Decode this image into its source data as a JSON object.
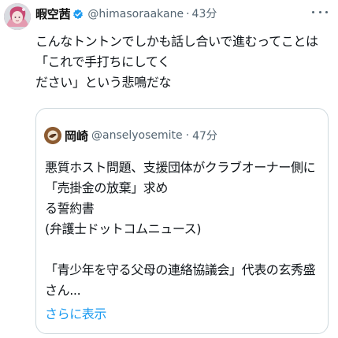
{
  "tweet": {
    "display_name": "暇空茜",
    "handle": "@himasoraakane",
    "separator": "·",
    "time": "43分",
    "text": "こんなトントンでしかも話し合いで進むってことは「これで手打ちにしてく\nださい」という悲鳴だな",
    "more_icon": "more-icon",
    "avatar_icon": "anime-avatar",
    "verified_icon": "verified-badge-icon",
    "accent": "#1d9bf0"
  },
  "quoted_tweet": {
    "display_name": "岡崎",
    "handle": "@anselyosemite",
    "separator": "·",
    "time": "47分",
    "text": "悪質ホスト問題、支援団体がクラブオーナー側に「売掛金の放棄」求め\nる誓約書\n(弁護士ドットコムニュース)\n\n「青少年を守る父母の連絡協議会」代表の玄秀盛さん...",
    "show_more": "さらに表示",
    "avatar_icon": "bird-avatar"
  }
}
